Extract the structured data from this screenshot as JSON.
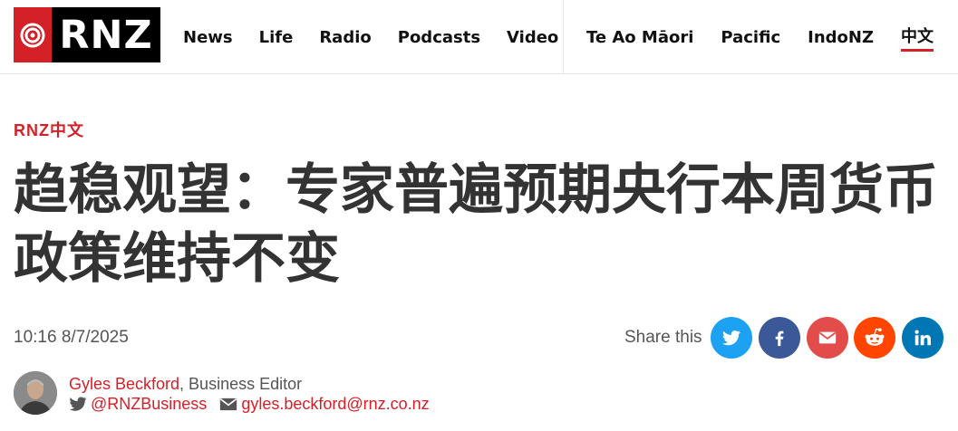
{
  "header": {
    "logo_text": "RNZ",
    "nav_main": [
      "News",
      "Life",
      "Radio",
      "Podcasts",
      "Video"
    ],
    "nav_secondary": [
      "Te Ao Māori",
      "Pacific",
      "IndoNZ",
      "中文"
    ]
  },
  "article": {
    "kicker": "RNZ中文",
    "headline": "趋稳观望：专家普遍预期央行本周货币政策维持不变",
    "timestamp": "10:16 8/7/2025"
  },
  "share": {
    "label": "Share this",
    "buttons": [
      "twitter-icon",
      "facebook-icon",
      "email-icon",
      "reddit-icon",
      "linkedin-icon"
    ]
  },
  "author": {
    "name": "Gyles Beckford",
    "role": ", Business Editor",
    "twitter": "@RNZBusiness",
    "email": "gyles.beckford@rnz.co.nz"
  },
  "colors": {
    "brand_red": "#d42027",
    "twitter": "#1da1f2",
    "facebook": "#3b5998",
    "email": "#e24c4b",
    "reddit": "#ff4500",
    "linkedin": "#0077b5"
  }
}
